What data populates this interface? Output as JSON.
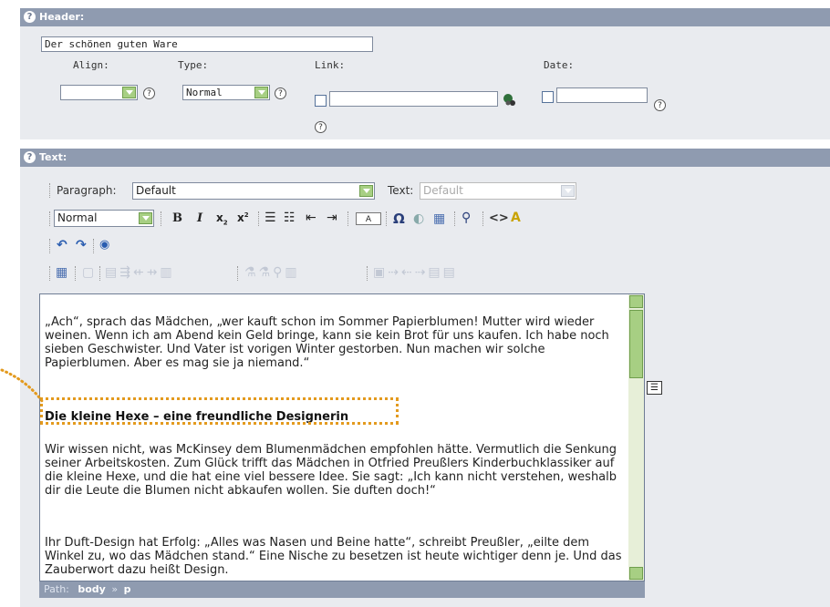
{
  "header_section": {
    "title": "Header:",
    "header_value": "Der schönen guten Ware",
    "align_label": "Align:",
    "align_value": "",
    "type_label": "Type:",
    "type_value": "Normal",
    "link_label": "Link:",
    "link_value": "",
    "date_label": "Date:",
    "date_value": ""
  },
  "text_section": {
    "title": "Text:",
    "paragraph_label": "Paragraph:",
    "paragraph_value": "Default",
    "text_label": "Text:",
    "text_value": "Default",
    "format_value": "Normal",
    "btn_a_label": "A"
  },
  "editor": {
    "para1": "„Ach“, sprach das Mädchen, „wer kauft schon im Sommer Papierblumen! Mutter wird wieder weinen. Wenn ich am Abend kein Geld bringe, kann sie kein Brot für uns kaufen. Ich habe noch sieben Geschwister. Und Vater ist vorigen Winter gestorben. Nun machen wir solche Papierblumen. Aber es mag sie ja niemand.“",
    "heading": "Die kleine Hexe – eine freundliche Designerin",
    "para2": "Wir wissen nicht, was McKinsey dem Blumenmädchen empfohlen hätte. Vermutlich die Senkung seiner Arbeitskosten. Zum Glück trifft das Mädchen in Otfried Preußlers Kinderbuchklassiker auf die kleine Hexe, und die hat eine viel bessere Idee. Sie sagt: „Ich kann nicht verstehen, weshalb dir die Leute die Blumen nicht abkaufen wollen. Sie duften doch!“",
    "para3": "Ihr Duft-Design hat Erfolg: „Alles was Nasen und Beine hatte“, schreibt Preußler, „eilte dem Winkel zu, wo das Mädchen stand.“ Eine Nische zu besetzen ist heute wichtiger denn je. Und das Zauberwort dazu heißt Design."
  },
  "path_bar": {
    "label": "Path:",
    "body": "body",
    "sep": "»",
    "p": "p"
  },
  "colors": {
    "section_bar": "#8f9bb0",
    "panel": "#e9ebef",
    "highlight_border": "#e39a1e"
  }
}
